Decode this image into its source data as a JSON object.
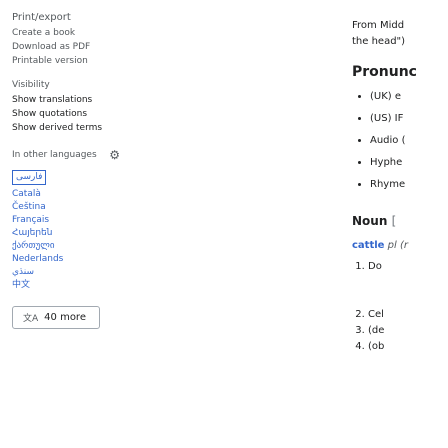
{
  "sidebar": {
    "print_heading": "Print/export",
    "print_items": [
      "Create a book",
      "Download as PDF",
      "Printable version"
    ],
    "visibility_heading": "Visibility",
    "visibility_items": [
      "Show translations",
      "Show quotations",
      "Show derived terms"
    ],
    "languages_heading": "In other languages",
    "languages": [
      "فارسی",
      "Català",
      "Čeština",
      "Français",
      "Հայերեն",
      "ქართული",
      "Nederlands",
      "سنڌي",
      "中文"
    ],
    "more_button": "40 more"
  },
  "main": {
    "from_line1": "From Midd",
    "from_line2": "the head\")",
    "pronunciation_heading": "Pronunc",
    "pron_items": [
      "(UK) e",
      "(US) IF",
      "Audio (",
      "Hyphe",
      "Rhyme"
    ],
    "noun_heading": "Noun",
    "noun_bracket": "[",
    "def_word": "cattle",
    "def_tail": "pl (r",
    "senses": [
      "Do",
      "Cel",
      "(de",
      "(ob"
    ]
  }
}
